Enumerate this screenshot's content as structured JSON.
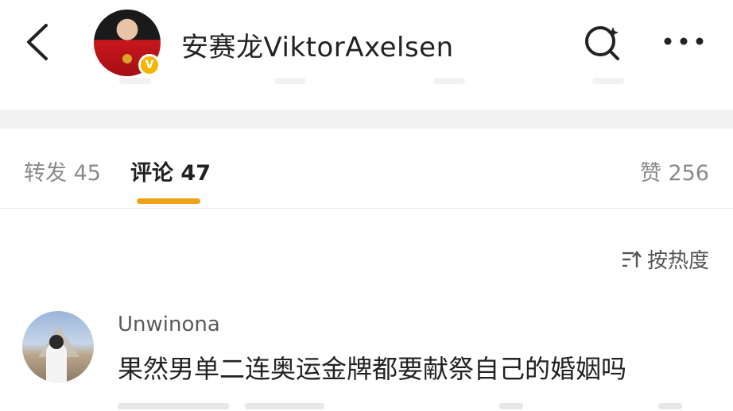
{
  "header": {
    "username": "安赛龙ViktorAxelsen",
    "verified_badge": "V",
    "icons": [
      "chevron-left-icon",
      "search-icon",
      "more-icon"
    ]
  },
  "tabs": [
    {
      "label": "转发",
      "count": "45",
      "active": false
    },
    {
      "label": "评论",
      "count": "47",
      "active": true
    },
    {
      "label": "赞",
      "count": "256",
      "active": false
    }
  ],
  "sort": {
    "label": "按热度",
    "icon": "sort-icon"
  },
  "comments": [
    {
      "user": "Unwinona",
      "text": "果然男单二连奥运金牌都要献祭自己的婚姻吗"
    }
  ],
  "colors": {
    "accent": "#f0a11a",
    "verified": "#f5b400",
    "muted": "#8a8a8a"
  }
}
